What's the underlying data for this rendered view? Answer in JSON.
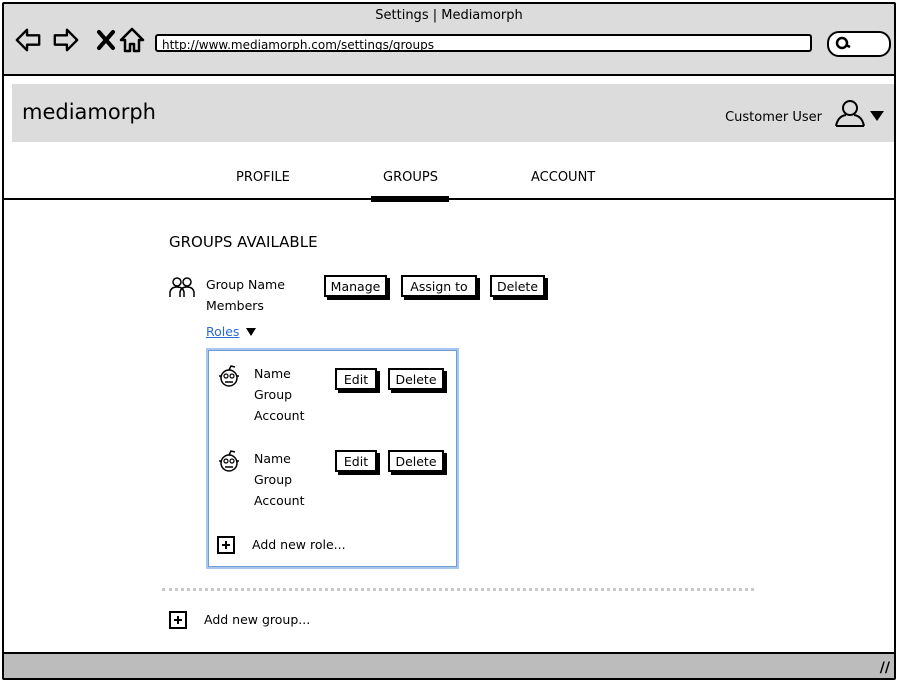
{
  "window": {
    "title": "Settings | Mediamorph"
  },
  "browser": {
    "url": "http://www.mediamorph.com/settings/groups",
    "icons": [
      "back-icon",
      "forward-icon",
      "close-icon",
      "home-icon",
      "search-icon"
    ]
  },
  "header": {
    "logo": "mediamorph",
    "user_name": "Customer User"
  },
  "tabs": [
    {
      "label": "PROFILE",
      "active": false
    },
    {
      "label": "GROUPS",
      "active": true
    },
    {
      "label": "ACCOUNT",
      "active": false
    }
  ],
  "groups": {
    "title": "GROUPS AVAILABLE",
    "group": {
      "name": "Group Name",
      "members": "Members",
      "buttons": {
        "manage": "Manage",
        "assign": "Assign to",
        "delete": "Delete"
      },
      "roles_label": "Roles",
      "roles": [
        {
          "name": "Name",
          "group": "Group",
          "account": "Account",
          "edit": "Edit",
          "delete": "Delete"
        },
        {
          "name": "Name",
          "group": "Group",
          "account": "Account",
          "edit": "Edit",
          "delete": "Delete"
        }
      ],
      "add_role": "Add new role..."
    },
    "add_group": "Add new group..."
  },
  "colors": {
    "chrome": "#dcdcdc",
    "link": "#2a6bd5",
    "roles_border": "#a9c6ef"
  }
}
